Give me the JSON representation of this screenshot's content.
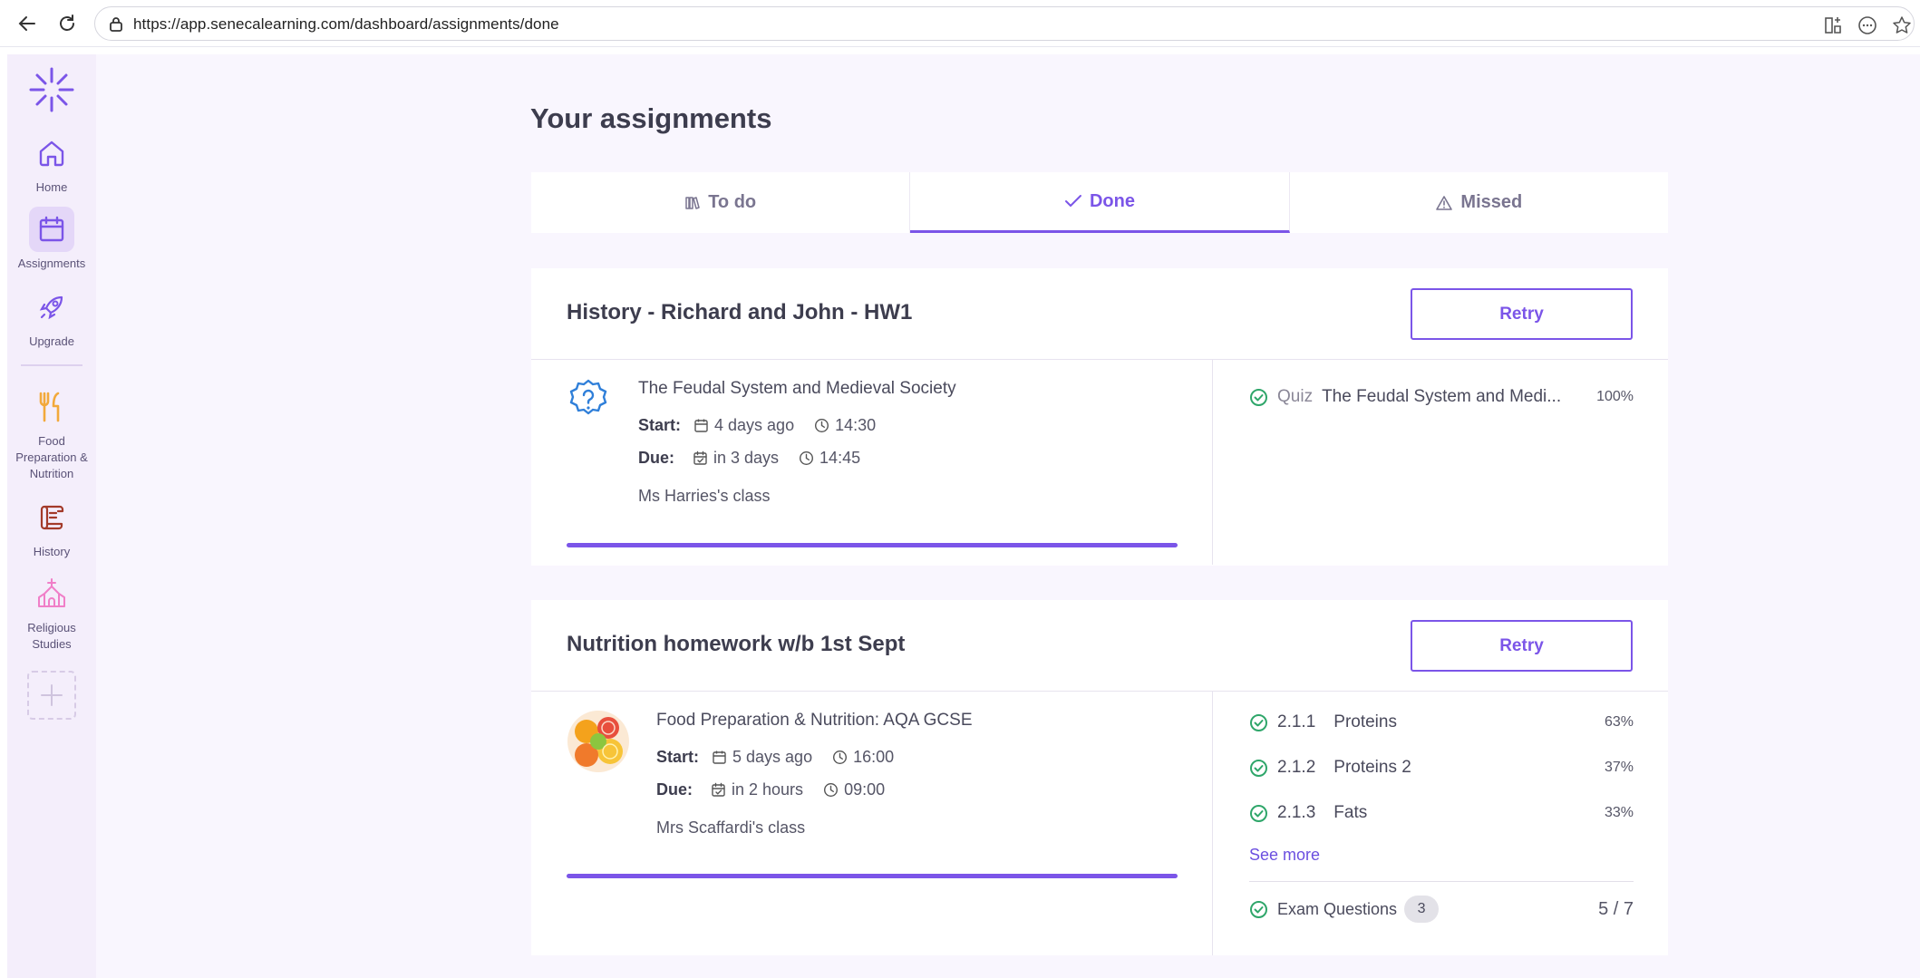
{
  "browser": {
    "url": "https://app.senecalearning.com/dashboard/assignments/done"
  },
  "sidebar": {
    "items": [
      {
        "label": "Home",
        "icon": "home-icon"
      },
      {
        "label": "Assignments",
        "icon": "calendar-icon"
      },
      {
        "label": "Upgrade",
        "icon": "rocket-icon"
      },
      {
        "label": "Food Preparation & Nutrition",
        "icon": "fork-knife-icon",
        "color": "#f2a93b"
      },
      {
        "label": "History",
        "icon": "scroll-icon",
        "color": "#a33a2a"
      },
      {
        "label": "Religious Studies",
        "icon": "church-icon",
        "color": "#f07fc8"
      }
    ]
  },
  "page": {
    "title": "Your assignments"
  },
  "tabs": [
    {
      "label": "To do",
      "icon": "books-icon"
    },
    {
      "label": "Done",
      "icon": "check-icon",
      "active": true
    },
    {
      "label": "Missed",
      "icon": "warning-icon"
    }
  ],
  "assignments": [
    {
      "title": "History - Richard and John - HW1",
      "retry_label": "Retry",
      "course": "The Feudal System and Medieval Society",
      "start_label": "Start:",
      "start_when": "4 days ago",
      "start_time": "14:30",
      "due_label": "Due:",
      "due_when": "in 3 days",
      "due_time": "14:45",
      "class": "Ms Harries's class",
      "progress": 1.0,
      "results": [
        {
          "kind": "Quiz",
          "name": "The Feudal System and Medi...",
          "pct": "100%"
        }
      ]
    },
    {
      "title": "Nutrition homework w/b 1st Sept",
      "retry_label": "Retry",
      "course": "Food Preparation & Nutrition: AQA GCSE",
      "start_label": "Start:",
      "start_when": "5 days ago",
      "start_time": "16:00",
      "due_label": "Due:",
      "due_when": "in 2 hours",
      "due_time": "09:00",
      "class": "Mrs Scaffardi's class",
      "progress": 1.0,
      "results": [
        {
          "code": "2.1.1",
          "name": "Proteins",
          "pct": "63%"
        },
        {
          "code": "2.1.2",
          "name": "Proteins 2",
          "pct": "37%"
        },
        {
          "code": "2.1.3",
          "name": "Fats",
          "pct": "33%"
        }
      ],
      "see_more": "See more",
      "exam": {
        "label": "Exam Questions",
        "count": "3",
        "score": "5 / 7"
      }
    }
  ],
  "colors": {
    "accent": "#7b55e8",
    "success": "#2fa66a",
    "sidebar_bg": "#f4eefb",
    "page_bg": "#f9f6fe"
  }
}
